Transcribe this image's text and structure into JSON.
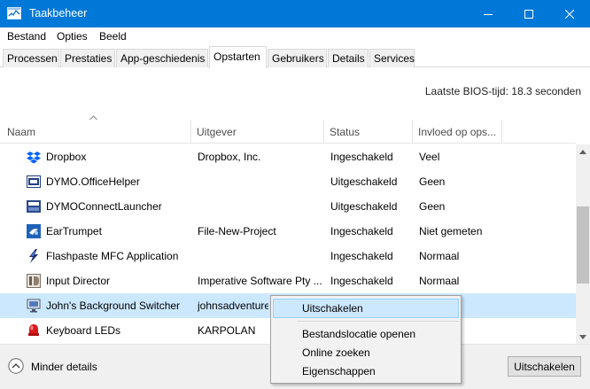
{
  "window": {
    "title": "Taakbeheer",
    "accent_color": "#0078d7",
    "controls": [
      "minimize-icon",
      "maximize-icon",
      "close-icon"
    ]
  },
  "menu": [
    "Bestand",
    "Opties",
    "Beeld"
  ],
  "tabs": [
    "Processen",
    "Prestaties",
    "App-geschiedenis",
    "Opstarten",
    "Gebruikers",
    "Details",
    "Services"
  ],
  "active_tab": "Opstarten",
  "bios": {
    "label": "Laatste BIOS-tijd:",
    "value": "18.3 seconden"
  },
  "columns": [
    "Naam",
    "Uitgever",
    "Status",
    "Invloed op ops..."
  ],
  "sort": {
    "column": "Naam",
    "direction": "ascending"
  },
  "rows": [
    {
      "icon": "dropbox-icon",
      "name": "Dropbox",
      "publisher": "Dropbox, Inc.",
      "status": "Ingeschakeld",
      "impact": "Veel"
    },
    {
      "icon": "dymo-icon",
      "name": "DYMO.OfficeHelper",
      "publisher": "",
      "status": "Uitgeschakeld",
      "impact": "Geen"
    },
    {
      "icon": "dymo-connect-icon",
      "name": "DYMOConnectLauncher",
      "publisher": "",
      "status": "Uitgeschakeld",
      "impact": "Geen"
    },
    {
      "icon": "eartrumpet-icon",
      "name": "EarTrumpet",
      "publisher": "File-New-Project",
      "status": "Ingeschakeld",
      "impact": "Niet gemeten"
    },
    {
      "icon": "flashpaste-icon",
      "name": "Flashpaste MFC Application",
      "publisher": "",
      "status": "Ingeschakeld",
      "impact": "Normaal"
    },
    {
      "icon": "input-director-icon",
      "name": "Input Director",
      "publisher": "Imperative Software Pty ...",
      "status": "Ingeschakeld",
      "impact": "Normaal"
    },
    {
      "icon": "background-switcher-icon",
      "name": "John's Background Switcher",
      "publisher": "johnsadventure",
      "status": "",
      "impact": ""
    },
    {
      "icon": "keyboard-leds-icon",
      "name": "Keyboard LEDs",
      "publisher": "KARPOLAN",
      "status": "",
      "impact": ""
    }
  ],
  "selected_row": "John's Background Switcher",
  "context_menu": {
    "items": [
      "Uitschakelen",
      "Bestandslocatie openen",
      "Online zoeken",
      "Eigenschappen"
    ],
    "highlighted": "Uitschakelen"
  },
  "footer": {
    "fewer_details": "Minder details",
    "disable_button": "Uitschakelen"
  }
}
